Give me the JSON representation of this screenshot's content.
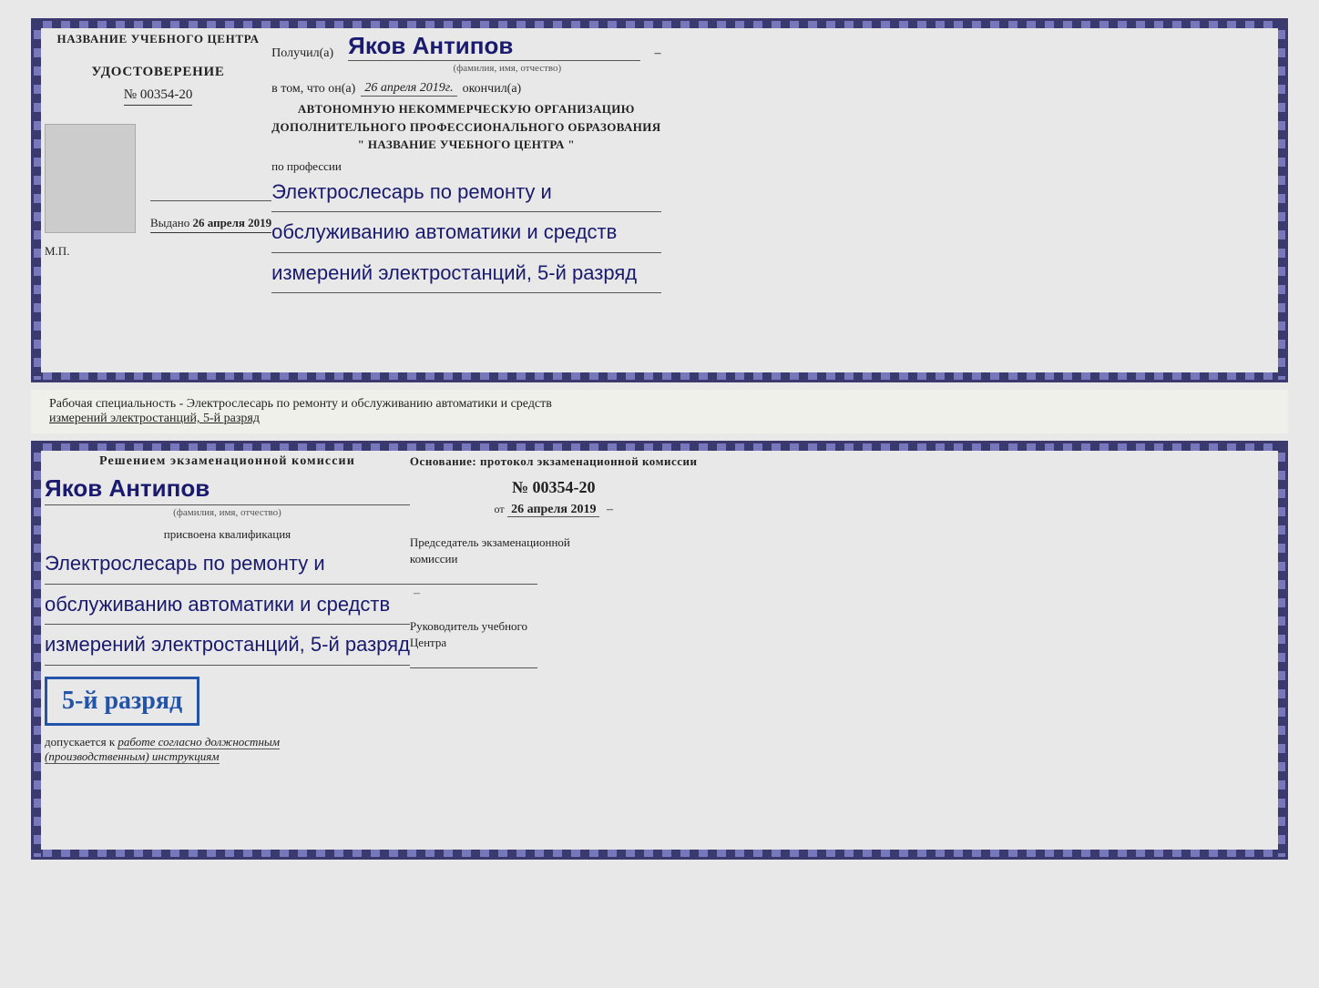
{
  "top_doc": {
    "left": {
      "center_name": "НАЗВАНИЕ УЧЕБНОГО ЦЕНТРА",
      "title": "УДОСТОВЕРЕНИЕ",
      "number": "№ 00354-20",
      "vydano_label": "Выдано",
      "vydano_date": "26 апреля 2019",
      "mp_label": "М.П."
    },
    "right": {
      "poluchil_label": "Получил(а)",
      "recipient_name": "Яков Антипов",
      "fio_caption": "(фамилия, имя, отчество)",
      "vtom_prefix": "в том, что он(а)",
      "vtom_date": "26 апреля 2019г.",
      "vtom_suffix": "окончил(а)",
      "org_line1": "АВТОНОМНУЮ НЕКОММЕРЧЕСКУЮ ОРГАНИЗАЦИЮ",
      "org_line2": "ДОПОЛНИТЕЛЬНОГО ПРОФЕССИОНАЛЬНОГО ОБРАЗОВАНИЯ",
      "org_quote": "\" НАЗВАНИЕ УЧЕБНОГО ЦЕНТРА \"",
      "po_professii": "по профессии",
      "profession_line1": "Электрослесарь по ремонту и",
      "profession_line2": "обслуживанию автоматики и средств",
      "profession_line3": "измерений электростанций, 5-й разряд"
    }
  },
  "middle_text": {
    "line1": "Рабочая специальность - Электрослесарь по ремонту и обслуживанию автоматики и средств",
    "line2": "измерений электростанций, 5-й разряд"
  },
  "bottom_doc": {
    "left": {
      "resheniem_label": "Решением экзаменационной комиссии",
      "recipient_name": "Яков Антипов",
      "fio_caption": "(фамилия, имя, отчество)",
      "prisvoena_label": "присвоена квалификация",
      "profession_line1": "Электрослесарь по ремонту и",
      "profession_line2": "обслуживанию автоматики и средств",
      "profession_line3": "измерений электростанций, 5-й разряд",
      "razryad_badge": "5-й разряд",
      "dopuskaetsya_prefix": "допускается к",
      "dopuskaetsya_text": "работе согласно должностным",
      "dopuskaetsya_text2": "(производственным) инструкциям"
    },
    "right": {
      "osnovanie_label": "Основание: протокол экзаменационной комиссии",
      "protocol_num": "№ 00354-20",
      "ot_prefix": "от",
      "ot_date": "26 апреля 2019",
      "chairman_label": "Председатель экзаменационной",
      "chairman_label2": "комиссии",
      "ruk_label": "Руководитель учебного",
      "ruk_label2": "Центра"
    }
  }
}
